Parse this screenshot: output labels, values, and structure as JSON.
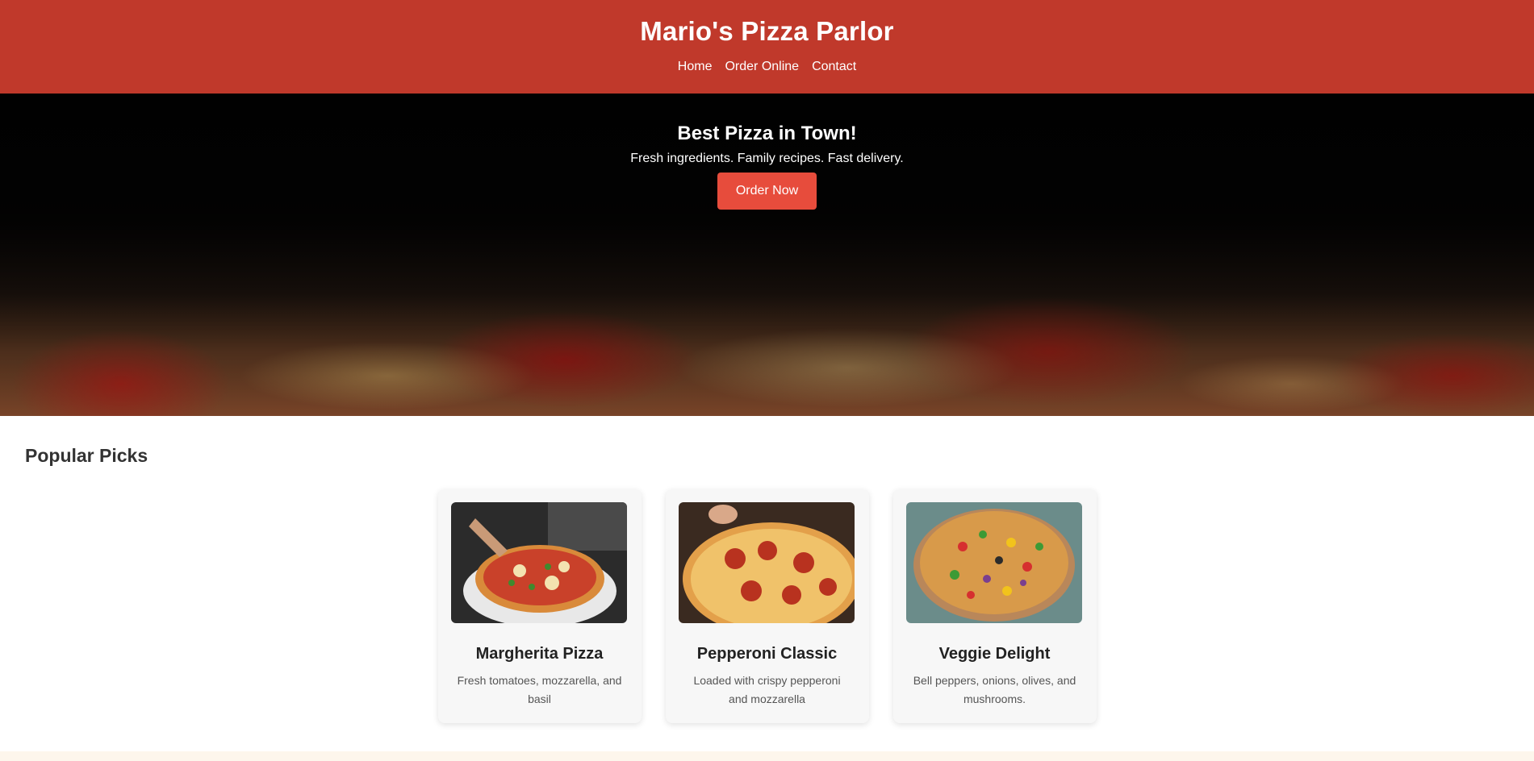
{
  "header": {
    "title": "Mario's Pizza Parlor",
    "nav": [
      {
        "label": "Home"
      },
      {
        "label": "Order Online"
      },
      {
        "label": "Contact"
      }
    ]
  },
  "hero": {
    "title": "Best Pizza in Town!",
    "subtitle": "Fresh ingredients. Family recipes. Fast delivery.",
    "button_label": "Order Now"
  },
  "popular": {
    "heading": "Popular Picks",
    "items": [
      {
        "name": "Margherita Pizza",
        "description": "Fresh tomatoes, mozzarella, and basil"
      },
      {
        "name": "Pepperoni Classic",
        "description": "Loaded with crispy pepperoni and mozzarella"
      },
      {
        "name": "Veggie Delight",
        "description": "Bell peppers, onions, olives, and mushrooms."
      }
    ]
  },
  "colors": {
    "header_bg": "#c0392b",
    "button_bg": "#e74c3c",
    "card_bg": "#f7f7f7"
  }
}
